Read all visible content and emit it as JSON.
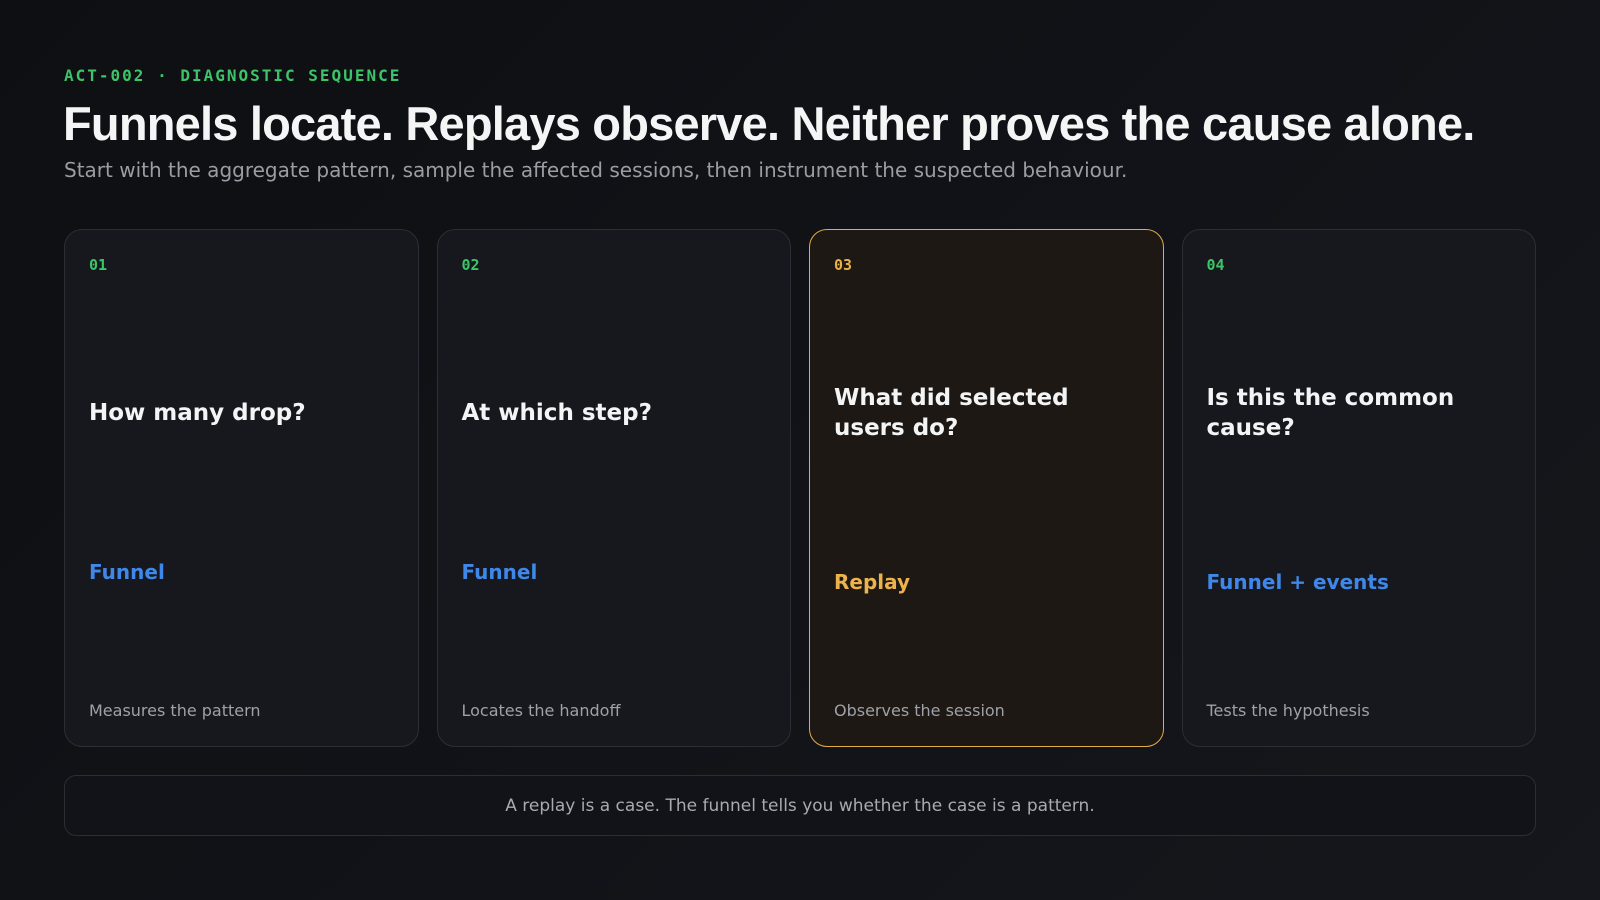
{
  "header": {
    "eyebrow": "ACT-002 · DIAGNOSTIC SEQUENCE",
    "title": "Funnels locate. Replays observe. Neither proves the cause alone.",
    "subtitle": "Start with the aggregate pattern, sample the affected sessions, then instrument the suspected behaviour."
  },
  "cards": [
    {
      "number": "01",
      "question": "How many drop?",
      "method": "Funnel",
      "caption": "Measures the pattern",
      "highlighted": false
    },
    {
      "number": "02",
      "question": "At which step?",
      "method": "Funnel",
      "caption": "Locates the handoff",
      "highlighted": false
    },
    {
      "number": "03",
      "question": "What did selected users do?",
      "method": "Replay",
      "caption": "Observes the session",
      "highlighted": true
    },
    {
      "number": "04",
      "question": "Is this the common cause?",
      "method": "Funnel + events",
      "caption": "Tests the hypothesis",
      "highlighted": false
    }
  ],
  "footer": {
    "note": "A replay is a case. The funnel tells you whether the case is a pattern."
  },
  "colors": {
    "accent_green": "#3cc468",
    "accent_blue": "#3f87e8",
    "accent_amber": "#e3ad46",
    "background": "#111318"
  }
}
